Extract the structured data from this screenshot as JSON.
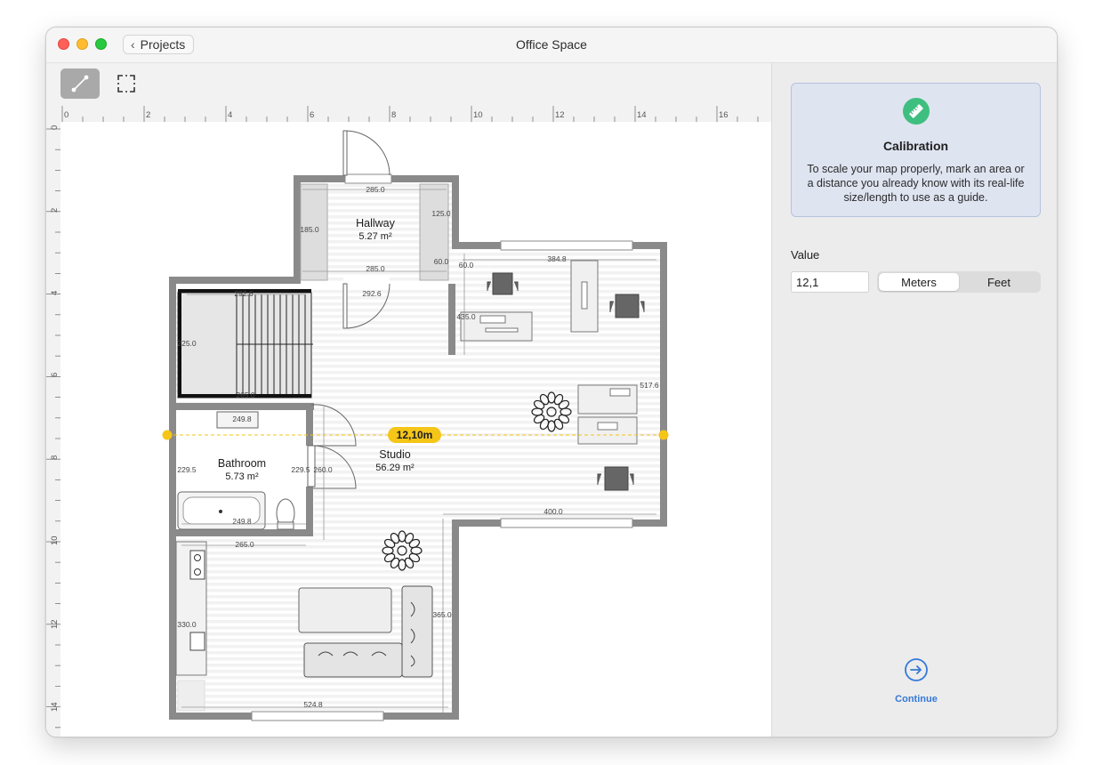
{
  "window": {
    "title": "Office Space",
    "back_label": "Projects"
  },
  "toolbar": {
    "tools": [
      {
        "icon": "calibrate-line-icon",
        "active": true
      },
      {
        "icon": "calibrate-area-icon",
        "active": false
      }
    ]
  },
  "ruler": {
    "top_labels": [
      "0",
      "2",
      "4",
      "6",
      "8",
      "10",
      "12",
      "14",
      "16"
    ],
    "left_labels": [
      "0",
      "2",
      "4",
      "6",
      "8",
      "10",
      "12",
      "14"
    ]
  },
  "floorplan": {
    "rooms": [
      {
        "name": "Hallway",
        "area": "5.27 m²"
      },
      {
        "name": "Bathroom",
        "area": "5.73 m²"
      },
      {
        "name": "Studio",
        "area": "56.29 m²"
      }
    ],
    "dimensions": [
      "285.0",
      "125.0",
      "185.0",
      "60.0",
      "285.0",
      "292.6",
      "384.8",
      "60.0",
      "435.0",
      "225.0",
      "517.6",
      "265.0",
      "249.8",
      "229.5",
      "229.5",
      "260.0",
      "249.8",
      "400.0",
      "265.0",
      "365.0",
      "330.0",
      "524.8",
      "292.6"
    ],
    "calibration_label": "12,10m"
  },
  "panel": {
    "card_icon": "ruler-icon",
    "card_title": "Calibration",
    "card_description": "To scale your map properly, mark an area or a distance you already know with its real-life size/length to use as a guide.",
    "value_label": "Value",
    "value": "12,1",
    "units": [
      {
        "label": "Meters",
        "selected": true
      },
      {
        "label": "Feet",
        "selected": false
      }
    ],
    "continue_label": "Continue"
  },
  "colors": {
    "accent": "#3478d8",
    "calibration": "#f5c518",
    "badge": "#3ebf7f",
    "wall": "#8a8a8a"
  }
}
